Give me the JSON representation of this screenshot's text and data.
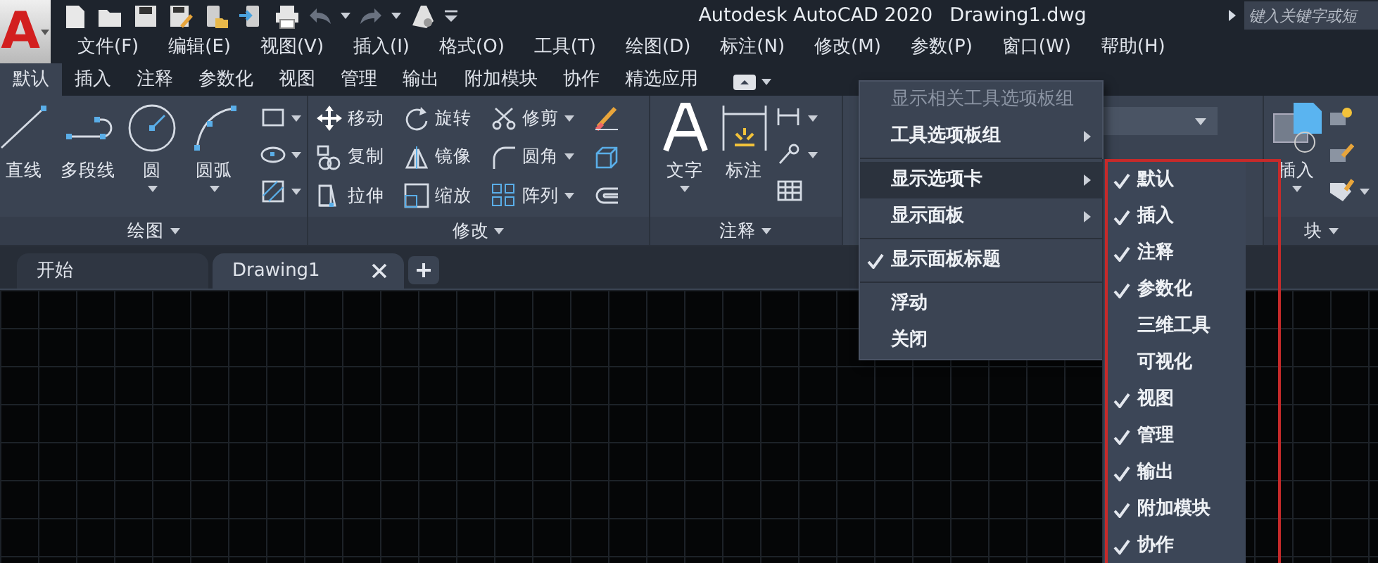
{
  "title_bar": {
    "logo": "A",
    "app_name": "Autodesk AutoCAD 2020",
    "document": "Drawing1.dwg",
    "search": {
      "placeholder": "键入关键字或短"
    }
  },
  "menu_bar": [
    "文件(F)",
    "编辑(E)",
    "视图(V)",
    "插入(I)",
    "格式(O)",
    "工具(T)",
    "绘图(D)",
    "标注(N)",
    "修改(M)",
    "参数(P)",
    "窗口(W)",
    "帮助(H)"
  ],
  "ribbon_tabs": [
    {
      "label": "默认",
      "selected": true
    },
    {
      "label": "插入",
      "selected": false
    },
    {
      "label": "注释",
      "selected": false
    },
    {
      "label": "参数化",
      "selected": false
    },
    {
      "label": "视图",
      "selected": false
    },
    {
      "label": "管理",
      "selected": false
    },
    {
      "label": "输出",
      "selected": false
    },
    {
      "label": "附加模块",
      "selected": false
    },
    {
      "label": "协作",
      "selected": false
    },
    {
      "label": "精选应用",
      "selected": false
    }
  ],
  "ribbon_panels": [
    {
      "kind": "draw",
      "title": "绘图",
      "tools": [
        {
          "label": "直线",
          "dropdown": false
        },
        {
          "label": "多段线",
          "dropdown": false
        },
        {
          "label": "圆",
          "dropdown": true
        },
        {
          "label": "圆弧",
          "dropdown": true
        }
      ]
    },
    {
      "kind": "modify",
      "title": "修改",
      "tools": [
        {
          "label": "移动",
          "dropdown": false
        },
        {
          "label": "旋转",
          "dropdown": false
        },
        {
          "label": "修剪",
          "dropdown": true
        },
        {
          "label": "复制",
          "dropdown": false
        },
        {
          "label": "镜像",
          "dropdown": false
        },
        {
          "label": "圆角",
          "dropdown": true
        },
        {
          "label": "拉伸",
          "dropdown": false
        },
        {
          "label": "缩放",
          "dropdown": false
        },
        {
          "label": "阵列",
          "dropdown": true
        }
      ]
    },
    {
      "kind": "annotate",
      "title": "注释",
      "tools": [
        {
          "label": "文字",
          "dropdown": true
        },
        {
          "label": "标注",
          "dropdown": false
        }
      ]
    },
    {
      "kind": "layers"
    },
    {
      "kind": "block",
      "title": "块",
      "tools": [
        {
          "label": "插入",
          "dropdown": true
        }
      ]
    }
  ],
  "file_tabs": [
    {
      "label": "开始",
      "selected": false,
      "closable": false
    },
    {
      "label": "Drawing1",
      "selected": true,
      "closable": true
    }
  ],
  "context_menu": [
    {
      "kind": "item",
      "label": "显示相关工具选项板组",
      "disabled": true,
      "submenu": false,
      "checked": false,
      "selected": false
    },
    {
      "kind": "item",
      "label": "工具选项板组",
      "disabled": false,
      "submenu": true,
      "checked": false,
      "selected": false
    },
    {
      "kind": "separator"
    },
    {
      "kind": "item",
      "label": "显示选项卡",
      "disabled": false,
      "submenu": true,
      "checked": false,
      "selected": true
    },
    {
      "kind": "item",
      "label": "显示面板",
      "disabled": false,
      "submenu": true,
      "checked": false,
      "selected": false
    },
    {
      "kind": "separator"
    },
    {
      "kind": "item",
      "label": "显示面板标题",
      "disabled": false,
      "submenu": false,
      "checked": true,
      "selected": false
    },
    {
      "kind": "separator"
    },
    {
      "kind": "item",
      "label": "浮动",
      "disabled": false,
      "submenu": false,
      "checked": false,
      "selected": false
    },
    {
      "kind": "item",
      "label": "关闭",
      "disabled": false,
      "submenu": false,
      "checked": false,
      "selected": false
    }
  ],
  "submenu": [
    {
      "label": "默认",
      "checked": true
    },
    {
      "label": "插入",
      "checked": true
    },
    {
      "label": "注释",
      "checked": true
    },
    {
      "label": "参数化",
      "checked": true
    },
    {
      "label": "三维工具",
      "checked": false
    },
    {
      "label": "可视化",
      "checked": false
    },
    {
      "label": "视图",
      "checked": true
    },
    {
      "label": "管理",
      "checked": true
    },
    {
      "label": "输出",
      "checked": true
    },
    {
      "label": "附加模块",
      "checked": true
    },
    {
      "label": "协作",
      "checked": true
    }
  ]
}
